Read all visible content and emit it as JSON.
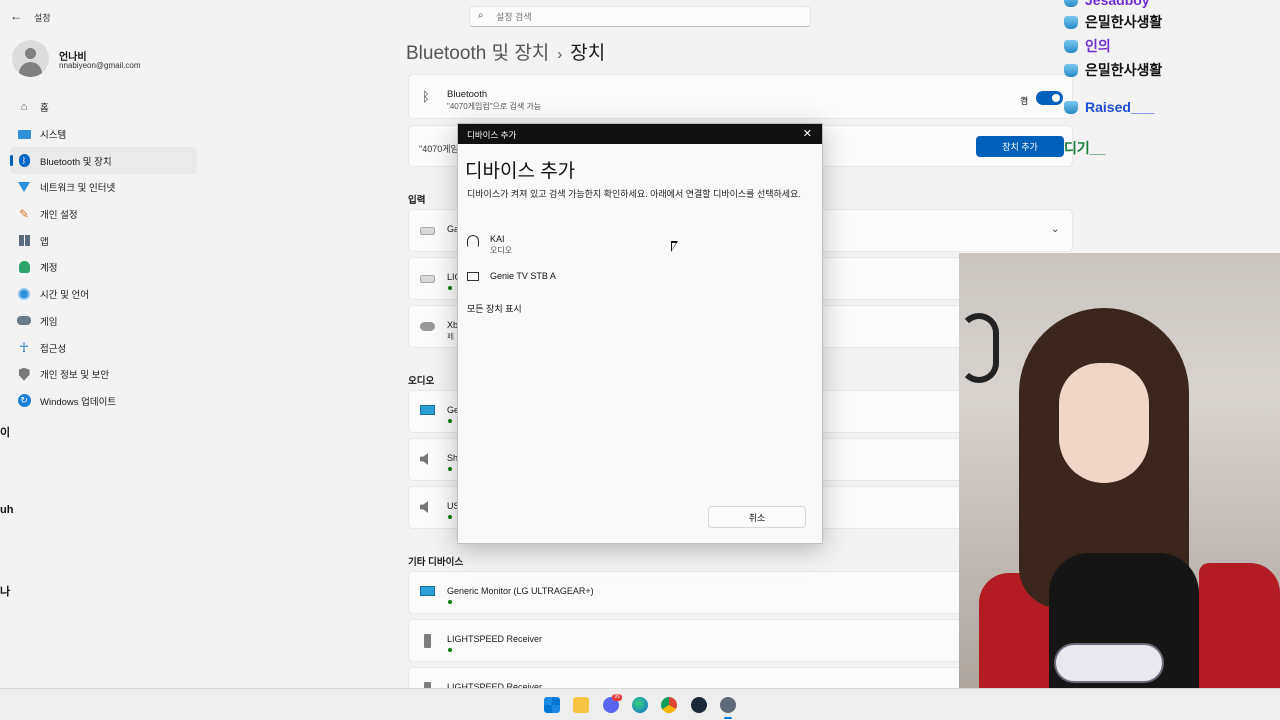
{
  "app": {
    "title": "설정"
  },
  "search": {
    "placeholder": "설정 검색"
  },
  "user": {
    "name": "언나비",
    "email": "nnabiyeon@gmail.com"
  },
  "sidebar": {
    "items": [
      {
        "label": "홈",
        "icon": "home-icon"
      },
      {
        "label": "시스템",
        "icon": "system-icon"
      },
      {
        "label": "Bluetooth 및 장치",
        "icon": "bluetooth-icon",
        "active": true
      },
      {
        "label": "네트워크 및 인터넷",
        "icon": "network-icon"
      },
      {
        "label": "개인 설정",
        "icon": "brush-icon"
      },
      {
        "label": "앱",
        "icon": "apps-icon"
      },
      {
        "label": "계정",
        "icon": "account-icon"
      },
      {
        "label": "시간 및 언어",
        "icon": "globe-clock-icon"
      },
      {
        "label": "게임",
        "icon": "gamepad-icon"
      },
      {
        "label": "접근성",
        "icon": "accessibility-icon"
      },
      {
        "label": "개인 정보 및 보안",
        "icon": "shield-icon"
      },
      {
        "label": "Windows 업데이트",
        "icon": "update-icon"
      }
    ]
  },
  "breadcrumb": {
    "parent": "Bluetooth 및 장치",
    "current": "장치"
  },
  "bluetooth": {
    "title": "Bluetooth",
    "subtitle": "\"4070게임컴\"으로 검색 가능",
    "toggle_label": "켬",
    "toggle_on": true
  },
  "add_device_row": {
    "text": "\"4070게임",
    "button": "장치 추가"
  },
  "sections": {
    "input": "입력",
    "audio": "오디오",
    "other": "기타 디바이스"
  },
  "input_devices": [
    {
      "name": "Ga",
      "icon": "keyboard-icon",
      "sub": ""
    },
    {
      "name": "LIG",
      "icon": "keyboard-icon",
      "sub": ""
    },
    {
      "name": "Xb",
      "icon": "gamepad-icon",
      "sub": "페"
    }
  ],
  "audio_devices": [
    {
      "name": "Gene",
      "icon": "monitor-icon"
    },
    {
      "name": "Sh",
      "icon": "speaker-icon"
    },
    {
      "name": "US",
      "icon": "speaker-icon"
    }
  ],
  "other_devices": [
    {
      "name": "Generic Monitor (LG ULTRAGEAR+)",
      "icon": "monitor-icon"
    },
    {
      "name": "LIGHTSPEED Receiver",
      "icon": "usb-receiver-icon"
    },
    {
      "name": "LIGHTSPEED Receiver",
      "icon": "usb-receiver-icon"
    }
  ],
  "dialog": {
    "titlebar": "디바이스 추가",
    "heading": "디바이스 추가",
    "description": "디바이스가 켜져 있고 검색 가능한지 확인하세요. 아래에서 연결할 디바이스를 선택하세요.",
    "devices": [
      {
        "name": "KAI",
        "sub": "오디오",
        "icon": "headset-icon"
      },
      {
        "name": "Genie TV STB A",
        "sub": "",
        "icon": "tv-icon"
      }
    ],
    "show_all": "모든 장치 표시",
    "cancel": "취소"
  },
  "side_glyphs": [
    "이",
    "uh",
    "나"
  ],
  "chat": [
    {
      "name": "Jesadboy",
      "color": "#6f2fd0"
    },
    {
      "name": "은밀한사생활",
      "color": "#111111"
    },
    {
      "name": "인의",
      "color": "#6f2fd0"
    },
    {
      "name": "은밀한사생활",
      "color": "#111111"
    },
    {
      "name": "Raised___",
      "color": "#1d4fd8"
    },
    {
      "name": "디기__",
      "color": "#1a7a3a"
    }
  ],
  "taskbar": {
    "icons": [
      "start-icon",
      "file-explorer-icon",
      "discord-icon",
      "edge-icon",
      "chrome-icon",
      "steam-icon",
      "settings-icon"
    ],
    "discord_badge": "99"
  }
}
